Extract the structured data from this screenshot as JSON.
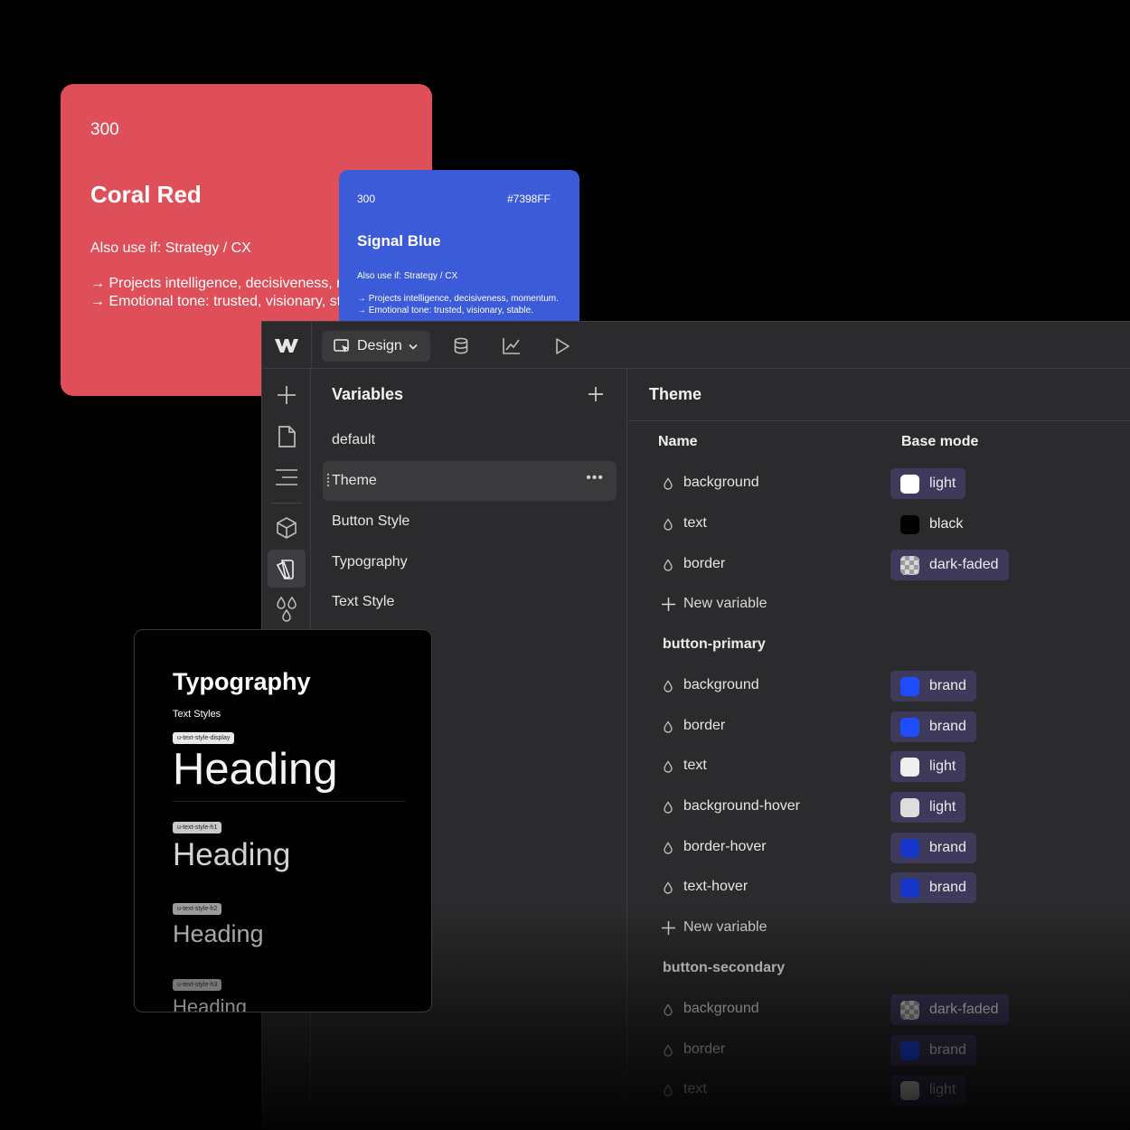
{
  "coral_card": {
    "shade": "300",
    "name": "Coral Red",
    "also_use": "Also use if: Strategy / CX",
    "line1": "→ Projects intelligence, decisiveness, momentum.",
    "line2": "→ Emotional tone: trusted, visionary, stable.",
    "color": "#df4f59"
  },
  "blue_card": {
    "shade": "300",
    "hex": "#7398FF",
    "name": "Signal Blue",
    "also_use": "Also use if: Strategy / CX",
    "line1": "→ Projects intelligence, decisiveness, momentum.",
    "line2": "→ Emotional tone: trusted, visionary, stable.",
    "color": "#3b5bd8"
  },
  "topbar": {
    "mode_label": "Design",
    "icons": [
      "webflow-logo",
      "cursor-mode-icon",
      "chevron-down-icon",
      "database-icon",
      "analytics-icon",
      "play-icon"
    ]
  },
  "rail": {
    "icons": [
      "add-icon",
      "page-icon",
      "navigator-icon",
      "components-icon",
      "variables-icon",
      "color-drops-icon"
    ]
  },
  "variables_panel": {
    "title": "Variables",
    "collections": [
      {
        "label": "default"
      },
      {
        "label": "Theme",
        "selected": true
      },
      {
        "label": "Button Style"
      },
      {
        "label": "Typography"
      },
      {
        "label": "Text Style"
      }
    ]
  },
  "theme_panel": {
    "title": "Theme",
    "col_name": "Name",
    "col_mode": "Base mode",
    "new_variable": "New variable",
    "rows": [
      {
        "name": "background",
        "value": "light",
        "swatch": "#ffffff"
      },
      {
        "name": "text",
        "value": "black",
        "swatch": "#000000"
      },
      {
        "name": "border",
        "value": "dark-faded",
        "swatch": "checker"
      }
    ],
    "groups": [
      {
        "title": "button-primary",
        "rows": [
          {
            "name": "background",
            "value": "brand",
            "swatch": "#1e4dff"
          },
          {
            "name": "border",
            "value": "brand",
            "swatch": "#1e4dff"
          },
          {
            "name": "text",
            "value": "light",
            "swatch": "#eeeeee"
          },
          {
            "name": "background-hover",
            "value": "light",
            "swatch": "#dddddd"
          },
          {
            "name": "border-hover",
            "value": "brand",
            "swatch": "#1536c8"
          },
          {
            "name": "text-hover",
            "value": "brand",
            "swatch": "#1536c8"
          }
        ]
      },
      {
        "title": "button-secondary",
        "rows": [
          {
            "name": "background",
            "value": "dark-faded",
            "swatch": "checker"
          },
          {
            "name": "border",
            "value": "brand",
            "swatch": "#1e4dff"
          },
          {
            "name": "text",
            "value": "light",
            "swatch": "#ffffff"
          }
        ]
      }
    ]
  },
  "typography_card": {
    "title": "Typography",
    "subtitle": "Text Styles",
    "samples": [
      {
        "tag": "u-text-style-display",
        "text": "Heading"
      },
      {
        "tag": "u-text-style-h1",
        "text": "Heading"
      },
      {
        "tag": "u-text-style-h2",
        "text": "Heading"
      },
      {
        "tag": "u-text-style-h3",
        "text": "Heading"
      }
    ]
  }
}
